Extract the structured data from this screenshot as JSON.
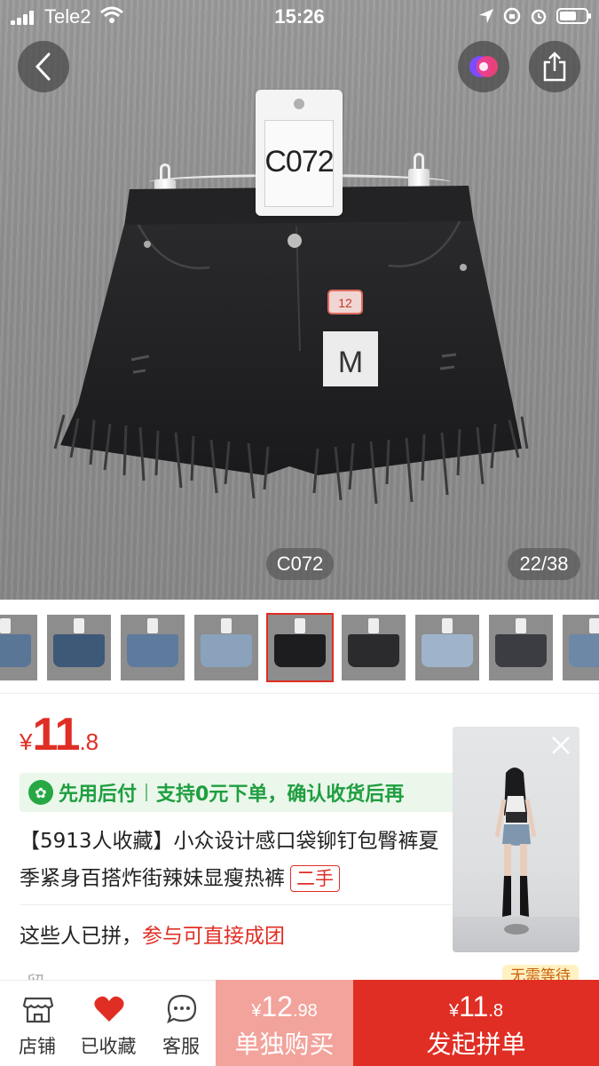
{
  "status_bar": {
    "carrier": "Tele2",
    "time": "15:26"
  },
  "hero": {
    "tag_code": "C072",
    "size_label": "M",
    "price_sticker": "12",
    "badge_code": "C072",
    "counter": "22/38"
  },
  "thumbnails": {
    "count": 9,
    "active_index": 4
  },
  "price": {
    "currency": "¥",
    "integer": "11",
    "decimal": ".8"
  },
  "promo": {
    "badge_text": "先用后付",
    "text": "支持0元下单，确认收货后再"
  },
  "title": {
    "text": "【5913人收藏】小众设计感口袋铆钉包臀裤夏季紧身百搭炸街辣妹显瘦热裤",
    "tag": "二手"
  },
  "group": {
    "prefix": "这些人已拼，",
    "highlight": "参与可直接成团"
  },
  "no_wait_tag": "无需等待",
  "partial_text": "留…",
  "bottom_bar": {
    "shop_label": "店铺",
    "favorite_label": "已收藏",
    "service_label": "客服",
    "single_buy": {
      "currency": "¥",
      "integer": "12",
      "decimal": ".98",
      "label": "单独购买"
    },
    "group_buy": {
      "currency": "¥",
      "integer": "11",
      "decimal": ".8",
      "label": "发起拼单"
    }
  },
  "colors": {
    "accent_red": "#e02e24",
    "single_buy_bg": "#f2a39b",
    "promo_green": "#1f9e40",
    "promo_bg": "#eaf7ea"
  }
}
